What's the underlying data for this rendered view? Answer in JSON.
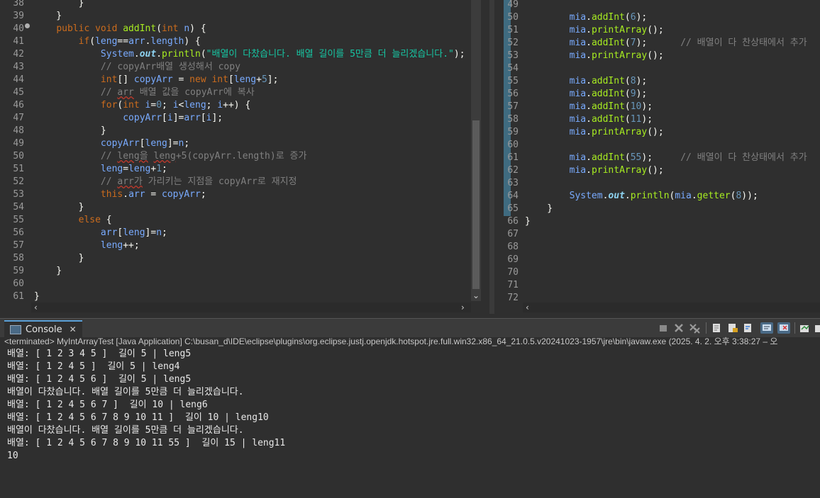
{
  "left_editor": {
    "lines": [
      {
        "n": "38",
        "parts": [
          {
            "c": "plain",
            "t": "        }"
          }
        ]
      },
      {
        "n": "39",
        "parts": [
          {
            "c": "plain",
            "t": "    }"
          }
        ]
      },
      {
        "n": "40",
        "parts": [
          {
            "c": "plain",
            "t": "    "
          },
          {
            "c": "kw",
            "t": "public void "
          },
          {
            "c": "fn",
            "t": "addInt"
          },
          {
            "c": "plain",
            "t": "("
          },
          {
            "c": "kw",
            "t": "int "
          },
          {
            "c": "var",
            "t": "n"
          },
          {
            "c": "plain",
            "t": ") {"
          }
        ]
      },
      {
        "n": "41",
        "parts": [
          {
            "c": "plain",
            "t": "        "
          },
          {
            "c": "kw",
            "t": "if"
          },
          {
            "c": "plain",
            "t": "("
          },
          {
            "c": "var",
            "t": "leng"
          },
          {
            "c": "plain",
            "t": "=="
          },
          {
            "c": "var",
            "t": "arr"
          },
          {
            "c": "plain",
            "t": "."
          },
          {
            "c": "var",
            "t": "length"
          },
          {
            "c": "plain",
            "t": ") {"
          }
        ]
      },
      {
        "n": "42",
        "parts": [
          {
            "c": "plain",
            "t": "            "
          },
          {
            "c": "var",
            "t": "System"
          },
          {
            "c": "plain",
            "t": "."
          },
          {
            "c": "st",
            "t": "out"
          },
          {
            "c": "plain",
            "t": "."
          },
          {
            "c": "fn",
            "t": "println"
          },
          {
            "c": "plain",
            "t": "("
          },
          {
            "c": "str",
            "t": "\"배열이 다찼습니다. 배열 길이를 5만큼 더 늘리겠습니다.\""
          },
          {
            "c": "plain",
            "t": ");"
          }
        ]
      },
      {
        "n": "43",
        "parts": [
          {
            "c": "plain",
            "t": "            "
          },
          {
            "c": "cm",
            "t": "// copyArr배열 생성해서 copy"
          }
        ]
      },
      {
        "n": "44",
        "parts": [
          {
            "c": "plain",
            "t": "            "
          },
          {
            "c": "kw",
            "t": "int"
          },
          {
            "c": "plain",
            "t": "[] "
          },
          {
            "c": "var",
            "t": "copyArr"
          },
          {
            "c": "plain",
            "t": " = "
          },
          {
            "c": "kw",
            "t": "new "
          },
          {
            "c": "kw",
            "t": "int"
          },
          {
            "c": "plain",
            "t": "["
          },
          {
            "c": "var",
            "t": "leng"
          },
          {
            "c": "plain",
            "t": "+"
          },
          {
            "c": "num",
            "t": "5"
          },
          {
            "c": "plain",
            "t": "];"
          }
        ]
      },
      {
        "n": "45",
        "parts": [
          {
            "c": "plain",
            "t": "            "
          },
          {
            "c": "cm",
            "t": "// "
          },
          {
            "c": "cm sqg",
            "t": "arr"
          },
          {
            "c": "cm",
            "t": " 배열 값을 copyArr에 복사"
          }
        ]
      },
      {
        "n": "46",
        "parts": [
          {
            "c": "plain",
            "t": "            "
          },
          {
            "c": "kw",
            "t": "for"
          },
          {
            "c": "plain",
            "t": "("
          },
          {
            "c": "kw",
            "t": "int "
          },
          {
            "c": "var",
            "t": "i"
          },
          {
            "c": "plain",
            "t": "="
          },
          {
            "c": "num",
            "t": "0"
          },
          {
            "c": "plain",
            "t": "; "
          },
          {
            "c": "var",
            "t": "i"
          },
          {
            "c": "plain",
            "t": "<"
          },
          {
            "c": "var",
            "t": "leng"
          },
          {
            "c": "plain",
            "t": "; "
          },
          {
            "c": "var",
            "t": "i"
          },
          {
            "c": "plain",
            "t": "++) {"
          }
        ]
      },
      {
        "n": "47",
        "parts": [
          {
            "c": "plain",
            "t": "                "
          },
          {
            "c": "var",
            "t": "copyArr"
          },
          {
            "c": "plain",
            "t": "["
          },
          {
            "c": "var",
            "t": "i"
          },
          {
            "c": "plain",
            "t": "]="
          },
          {
            "c": "var",
            "t": "arr"
          },
          {
            "c": "plain",
            "t": "["
          },
          {
            "c": "var",
            "t": "i"
          },
          {
            "c": "plain",
            "t": "];"
          }
        ]
      },
      {
        "n": "48",
        "parts": [
          {
            "c": "plain",
            "t": "            }"
          }
        ]
      },
      {
        "n": "49",
        "parts": [
          {
            "c": "plain",
            "t": "            "
          },
          {
            "c": "var",
            "t": "copyArr"
          },
          {
            "c": "plain",
            "t": "["
          },
          {
            "c": "var",
            "t": "leng"
          },
          {
            "c": "plain",
            "t": "]="
          },
          {
            "c": "var",
            "t": "n"
          },
          {
            "c": "plain",
            "t": ";"
          }
        ]
      },
      {
        "n": "50",
        "parts": [
          {
            "c": "plain",
            "t": "            "
          },
          {
            "c": "cm",
            "t": "// "
          },
          {
            "c": "cm sqg",
            "t": "leng을"
          },
          {
            "c": "cm",
            "t": " "
          },
          {
            "c": "cm sqg",
            "t": "leng"
          },
          {
            "c": "cm",
            "t": "+5(copyArr.length)로 증가"
          }
        ]
      },
      {
        "n": "51",
        "parts": [
          {
            "c": "plain",
            "t": "            "
          },
          {
            "c": "var",
            "t": "leng"
          },
          {
            "c": "plain",
            "t": "="
          },
          {
            "c": "var",
            "t": "leng"
          },
          {
            "c": "plain",
            "t": "+"
          },
          {
            "c": "num",
            "t": "1"
          },
          {
            "c": "plain",
            "t": ";"
          }
        ]
      },
      {
        "n": "52",
        "parts": [
          {
            "c": "plain",
            "t": "            "
          },
          {
            "c": "cm",
            "t": "// "
          },
          {
            "c": "cm sqg",
            "t": "arr가"
          },
          {
            "c": "cm",
            "t": " 가리키는 지점을 copyArr로 재지정"
          }
        ]
      },
      {
        "n": "53",
        "parts": [
          {
            "c": "plain",
            "t": "            "
          },
          {
            "c": "kw",
            "t": "this"
          },
          {
            "c": "plain",
            "t": "."
          },
          {
            "c": "var",
            "t": "arr"
          },
          {
            "c": "plain",
            "t": " = "
          },
          {
            "c": "var",
            "t": "copyArr"
          },
          {
            "c": "plain",
            "t": ";"
          }
        ]
      },
      {
        "n": "54",
        "parts": [
          {
            "c": "plain",
            "t": "        }"
          }
        ]
      },
      {
        "n": "55",
        "parts": [
          {
            "c": "plain",
            "t": "        "
          },
          {
            "c": "kw",
            "t": "else"
          },
          {
            "c": "plain",
            "t": " {"
          }
        ]
      },
      {
        "n": "56",
        "parts": [
          {
            "c": "plain",
            "t": "            "
          },
          {
            "c": "var",
            "t": "arr"
          },
          {
            "c": "plain",
            "t": "["
          },
          {
            "c": "var",
            "t": "leng"
          },
          {
            "c": "plain",
            "t": "]="
          },
          {
            "c": "var",
            "t": "n"
          },
          {
            "c": "plain",
            "t": ";"
          }
        ]
      },
      {
        "n": "57",
        "parts": [
          {
            "c": "plain",
            "t": "            "
          },
          {
            "c": "var",
            "t": "leng"
          },
          {
            "c": "plain",
            "t": "++;"
          }
        ]
      },
      {
        "n": "58",
        "parts": [
          {
            "c": "plain",
            "t": "        }"
          }
        ]
      },
      {
        "n": "59",
        "parts": [
          {
            "c": "plain",
            "t": "    }"
          }
        ]
      },
      {
        "n": "60",
        "parts": []
      },
      {
        "n": "61",
        "parts": [
          {
            "c": "plain",
            "t": "}"
          }
        ]
      }
    ]
  },
  "right_editor": {
    "lines": [
      {
        "n": "49",
        "parts": []
      },
      {
        "n": "50",
        "parts": [
          {
            "c": "plain",
            "t": "        "
          },
          {
            "c": "var",
            "t": "mia"
          },
          {
            "c": "plain",
            "t": "."
          },
          {
            "c": "fn",
            "t": "addInt"
          },
          {
            "c": "plain",
            "t": "("
          },
          {
            "c": "num",
            "t": "6"
          },
          {
            "c": "plain",
            "t": ");"
          }
        ]
      },
      {
        "n": "51",
        "parts": [
          {
            "c": "plain",
            "t": "        "
          },
          {
            "c": "var",
            "t": "mia"
          },
          {
            "c": "plain",
            "t": "."
          },
          {
            "c": "fn",
            "t": "printArray"
          },
          {
            "c": "plain",
            "t": "();"
          }
        ]
      },
      {
        "n": "52",
        "parts": [
          {
            "c": "plain",
            "t": "        "
          },
          {
            "c": "var",
            "t": "mia"
          },
          {
            "c": "plain",
            "t": "."
          },
          {
            "c": "fn",
            "t": "addInt"
          },
          {
            "c": "plain",
            "t": "("
          },
          {
            "c": "num",
            "t": "7"
          },
          {
            "c": "plain",
            "t": ");      "
          },
          {
            "c": "cm",
            "t": "// 배열이 다 찬상태에서 추가"
          }
        ]
      },
      {
        "n": "53",
        "parts": [
          {
            "c": "plain",
            "t": "        "
          },
          {
            "c": "var",
            "t": "mia"
          },
          {
            "c": "plain",
            "t": "."
          },
          {
            "c": "fn",
            "t": "printArray"
          },
          {
            "c": "plain",
            "t": "();"
          }
        ]
      },
      {
        "n": "54",
        "parts": []
      },
      {
        "n": "55",
        "parts": [
          {
            "c": "plain",
            "t": "        "
          },
          {
            "c": "var",
            "t": "mia"
          },
          {
            "c": "plain",
            "t": "."
          },
          {
            "c": "fn",
            "t": "addInt"
          },
          {
            "c": "plain",
            "t": "("
          },
          {
            "c": "num",
            "t": "8"
          },
          {
            "c": "plain",
            "t": ");"
          }
        ]
      },
      {
        "n": "56",
        "parts": [
          {
            "c": "plain",
            "t": "        "
          },
          {
            "c": "var",
            "t": "mia"
          },
          {
            "c": "plain",
            "t": "."
          },
          {
            "c": "fn",
            "t": "addInt"
          },
          {
            "c": "plain",
            "t": "("
          },
          {
            "c": "num",
            "t": "9"
          },
          {
            "c": "plain",
            "t": ");"
          }
        ]
      },
      {
        "n": "57",
        "parts": [
          {
            "c": "plain",
            "t": "        "
          },
          {
            "c": "var",
            "t": "mia"
          },
          {
            "c": "plain",
            "t": "."
          },
          {
            "c": "fn",
            "t": "addInt"
          },
          {
            "c": "plain",
            "t": "("
          },
          {
            "c": "num",
            "t": "10"
          },
          {
            "c": "plain",
            "t": ");"
          }
        ]
      },
      {
        "n": "58",
        "parts": [
          {
            "c": "plain",
            "t": "        "
          },
          {
            "c": "var",
            "t": "mia"
          },
          {
            "c": "plain",
            "t": "."
          },
          {
            "c": "fn",
            "t": "addInt"
          },
          {
            "c": "plain",
            "t": "("
          },
          {
            "c": "num",
            "t": "11"
          },
          {
            "c": "plain",
            "t": ");"
          }
        ]
      },
      {
        "n": "59",
        "parts": [
          {
            "c": "plain",
            "t": "        "
          },
          {
            "c": "var",
            "t": "mia"
          },
          {
            "c": "plain",
            "t": "."
          },
          {
            "c": "fn",
            "t": "printArray"
          },
          {
            "c": "plain",
            "t": "();"
          }
        ]
      },
      {
        "n": "60",
        "parts": []
      },
      {
        "n": "61",
        "parts": [
          {
            "c": "plain",
            "t": "        "
          },
          {
            "c": "var",
            "t": "mia"
          },
          {
            "c": "plain",
            "t": "."
          },
          {
            "c": "fn",
            "t": "addInt"
          },
          {
            "c": "plain",
            "t": "("
          },
          {
            "c": "num",
            "t": "55"
          },
          {
            "c": "plain",
            "t": ");     "
          },
          {
            "c": "cm",
            "t": "// 배열이 다 찬상태에서 추가"
          }
        ]
      },
      {
        "n": "62",
        "parts": [
          {
            "c": "plain",
            "t": "        "
          },
          {
            "c": "var",
            "t": "mia"
          },
          {
            "c": "plain",
            "t": "."
          },
          {
            "c": "fn",
            "t": "printArray"
          },
          {
            "c": "plain",
            "t": "();"
          }
        ]
      },
      {
        "n": "63",
        "parts": []
      },
      {
        "n": "64",
        "parts": [
          {
            "c": "plain",
            "t": "        "
          },
          {
            "c": "var",
            "t": "System"
          },
          {
            "c": "plain",
            "t": "."
          },
          {
            "c": "st",
            "t": "out"
          },
          {
            "c": "plain",
            "t": "."
          },
          {
            "c": "fn",
            "t": "println"
          },
          {
            "c": "plain",
            "t": "("
          },
          {
            "c": "var",
            "t": "mia"
          },
          {
            "c": "plain",
            "t": "."
          },
          {
            "c": "fn",
            "t": "getter"
          },
          {
            "c": "plain",
            "t": "("
          },
          {
            "c": "num",
            "t": "8"
          },
          {
            "c": "plain",
            "t": "));"
          }
        ]
      },
      {
        "n": "65",
        "parts": [
          {
            "c": "plain",
            "t": "    }"
          }
        ]
      },
      {
        "n": "66",
        "parts": [
          {
            "c": "plain",
            "t": "}"
          }
        ]
      },
      {
        "n": "67",
        "parts": []
      },
      {
        "n": "68",
        "parts": []
      },
      {
        "n": "69",
        "parts": []
      },
      {
        "n": "70",
        "parts": []
      },
      {
        "n": "71",
        "parts": []
      },
      {
        "n": "72",
        "parts": []
      }
    ]
  },
  "console": {
    "tab_label": "Console",
    "info": "<terminated> MyIntArrayTest [Java Application] C:\\busan_d\\IDE\\eclipse\\plugins\\org.eclipse.justj.openjdk.hotspot.jre.full.win32.x86_64_21.0.5.v20241023-1957\\jre\\bin\\javaw.exe  (2025. 4. 2. 오후 3:38:27 – 오",
    "output": [
      "배열: [ 1 2 3 4 5 ]  길이 5 | leng5",
      "배열: [ 1 2 4 5 ]  길이 5 | leng4",
      "배열: [ 1 2 4 5 6 ]  길이 5 | leng5",
      "배열이 다찼습니다. 배열 길이를 5만큼 더 늘리겠습니다.",
      "배열: [ 1 2 4 5 6 7 ]  길이 10 | leng6",
      "배열: [ 1 2 4 5 6 7 8 9 10 11 ]  길이 10 | leng10",
      "배열이 다찼습니다. 배열 길이를 5만큼 더 늘리겠습니다.",
      "배열: [ 1 2 4 5 6 7 8 9 10 11 55 ]  길이 15 | leng11",
      "10"
    ]
  }
}
